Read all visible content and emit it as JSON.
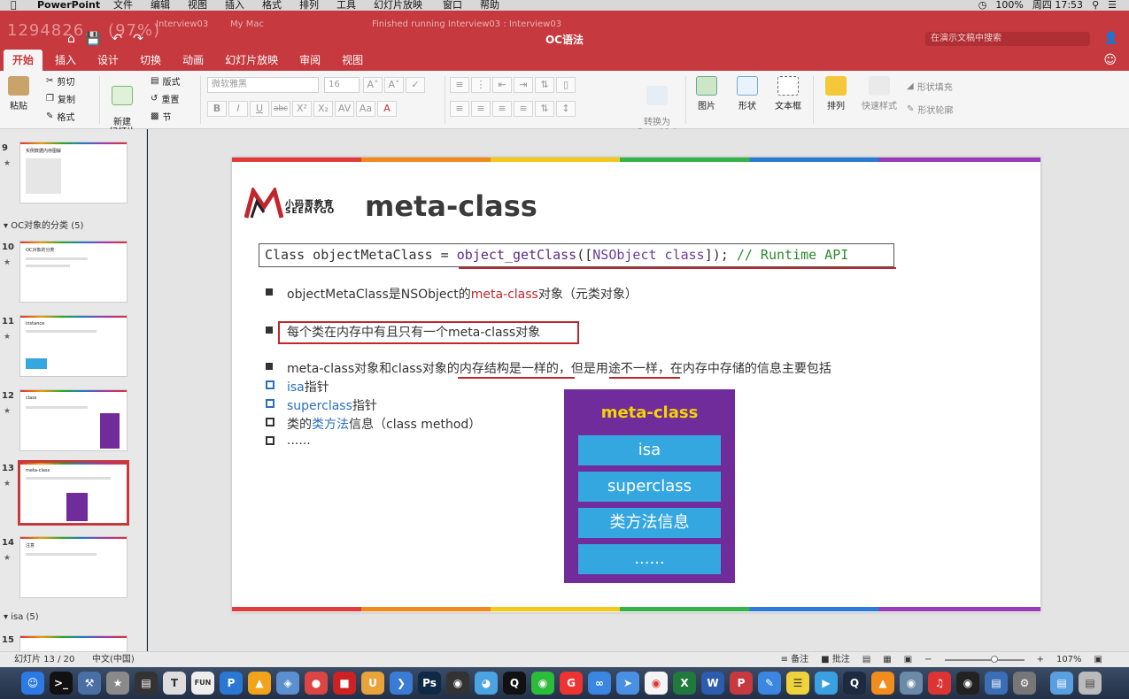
{
  "menubar": {
    "app": "PowerPoint",
    "items": [
      "文件",
      "编辑",
      "视图",
      "插入",
      "格式",
      "排列",
      "工具",
      "幻灯片放映",
      "窗口",
      "帮助"
    ],
    "battery": "100%",
    "clock": "周四 17:53"
  },
  "window": {
    "title": "OC语法",
    "ghost_tab1": "Interview03",
    "ghost_tab2": "My Mac",
    "ghost_status": "Finished running Interview03 : Interview03",
    "ghost_text": "1294826... (97%)",
    "search_placeholder": "在演示文稿中搜索"
  },
  "tabs": [
    "开始",
    "插入",
    "设计",
    "切换",
    "动画",
    "幻灯片放映",
    "审阅",
    "视图"
  ],
  "ribbon": {
    "paste": "粘贴",
    "cut": "剪切",
    "copy": "复制",
    "format": "格式",
    "new_slide": "新建\n幻灯片",
    "layout": "版式",
    "reset": "重置",
    "section": "节",
    "font_name": "微软雅黑",
    "font_size": "16",
    "convert": "转换为\nSmartArt",
    "picture": "图片",
    "shape": "形状",
    "textbox": "文本框",
    "arrange": "排列",
    "quick_styles": "快速样式",
    "shape_fill": "形状填充",
    "shape_outline": "形状轮廓"
  },
  "thumbs": {
    "section1": "OC对象的分类 (5)",
    "section2": "isa (5)",
    "nums": [
      "9",
      "10",
      "11",
      "12",
      "13",
      "14",
      "15"
    ],
    "titles": [
      "实例数据内存图解",
      "OC对象的分类",
      "instance",
      "class",
      "meta-class",
      "注意",
      ""
    ]
  },
  "slide": {
    "logo_cn": "小码哥教育",
    "logo_en": "SEEMYGO",
    "title": "meta-class",
    "code": {
      "p1": "Class objectMetaClass = ",
      "p2": "object_getClass",
      "p3": "([",
      "p4": "NSObject",
      "p5": " class",
      "p6": "]); ",
      "p7": "// Runtime API"
    },
    "b1a": "objectMetaClass是NSObject的",
    "b1b": "meta-class",
    "b1c": "对象（元类对象）",
    "b2": "每个类在内存中有且只有一个meta-class对象",
    "b3": "meta-class对象和class对象的内存结构是一样的，但是用途不一样，在内存中存储的信息主要包括",
    "s1a": "isa",
    "s1b": "指针",
    "s2a": "superclass",
    "s2b": "指针",
    "s3a": "类的",
    "s3b": "类方法",
    "s3c": "信息（class method）",
    "s4": "......",
    "diagram": {
      "header": "meta-class",
      "cells": [
        "isa",
        "superclass",
        "类方法信息",
        "......"
      ]
    }
  },
  "status": {
    "slide_info": "幻灯片 13 / 20",
    "language": "中文(中国)",
    "notes": "备注",
    "comments": "批注",
    "zoom": "107%"
  },
  "colors": {
    "accent": "#c6393e",
    "diagram_bg": "#6f2c9a",
    "diagram_cell": "#35a7e0",
    "diagram_header": "#f5d400",
    "underline": "#c0262c"
  }
}
